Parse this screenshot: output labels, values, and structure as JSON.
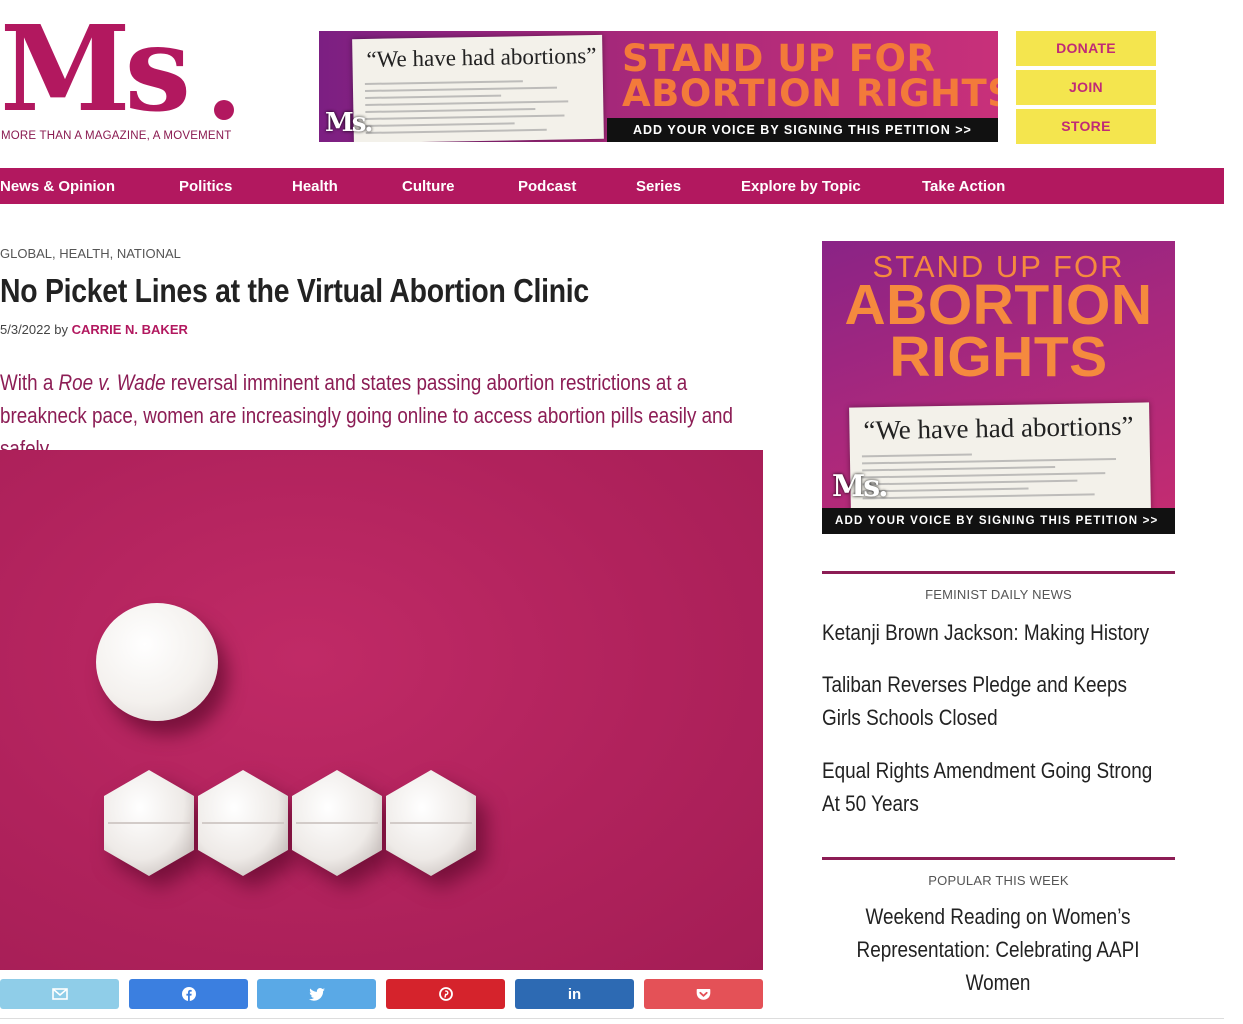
{
  "header": {
    "logo_text": "Ms",
    "tagline": "MORE THAN A MAGAZINE, A MOVEMENT",
    "banner": {
      "magazine_heading": "“We have had abortions”",
      "magazine_logo": "Ms.",
      "headline_line1": "STAND UP FOR",
      "headline_line2": "ABORTION RIGHTS",
      "cta": "ADD YOUR VOICE BY SIGNING THIS PETITION >>"
    },
    "utility": [
      "DONATE",
      "JOIN",
      "STORE"
    ]
  },
  "nav": {
    "items": [
      "News & Opinion",
      "Politics",
      "Health",
      "Culture",
      "Podcast",
      "Series",
      "Explore by Topic",
      "Take Action"
    ]
  },
  "article": {
    "categories": [
      "GLOBAL",
      "HEALTH",
      "NATIONAL"
    ],
    "title": "No Picket Lines at the Virtual Abortion Clinic",
    "date": "5/3/2022",
    "by": "by",
    "author": "CARRIE N. BAKER",
    "excerpt_pre": "With a ",
    "excerpt_case": "Roe v. Wade",
    "excerpt_post": " reversal imminent and states passing abortion restrictions at a breakneck pace, women are increasingly going online to access abortion pills easily and safely.",
    "share_buttons": [
      {
        "icon": "email-icon",
        "color": "#8fcde8"
      },
      {
        "icon": "facebook-icon",
        "color": "#3b7fe0"
      },
      {
        "icon": "twitter-icon",
        "color": "#5aa9e6"
      },
      {
        "icon": "pinterest-icon",
        "color": "#d5232c"
      },
      {
        "icon": "linkedin-icon",
        "color": "#2d6ab3"
      },
      {
        "icon": "pocket-icon",
        "color": "#e45157"
      }
    ]
  },
  "sidebar": {
    "banner": {
      "kicker": "STAND UP FOR",
      "line1": "ABORTION",
      "line2": "RIGHTS",
      "magazine_heading": "“We have had abortions”",
      "magazine_logo": "Ms.",
      "cta": "ADD YOUR VOICE BY SIGNING THIS PETITION >>"
    },
    "feminist_daily_news": {
      "heading": "FEMINIST DAILY NEWS",
      "items": [
        "Ketanji Brown Jackson: Making History",
        "Taliban Reverses Pledge and Keeps Girls Schools Closed",
        "Equal Rights Amendment Going Strong At 50 Years"
      ]
    },
    "popular": {
      "heading": "POPULAR THIS WEEK",
      "items": [
        "Weekend Reading on Women’s Representation: Celebrating AAPI Women"
      ]
    }
  },
  "colors": {
    "brand": "#b2185f",
    "excerpt": "#8c1d55",
    "utility_bg": "#f4e54e",
    "banner_orange": "#f37a3a"
  }
}
